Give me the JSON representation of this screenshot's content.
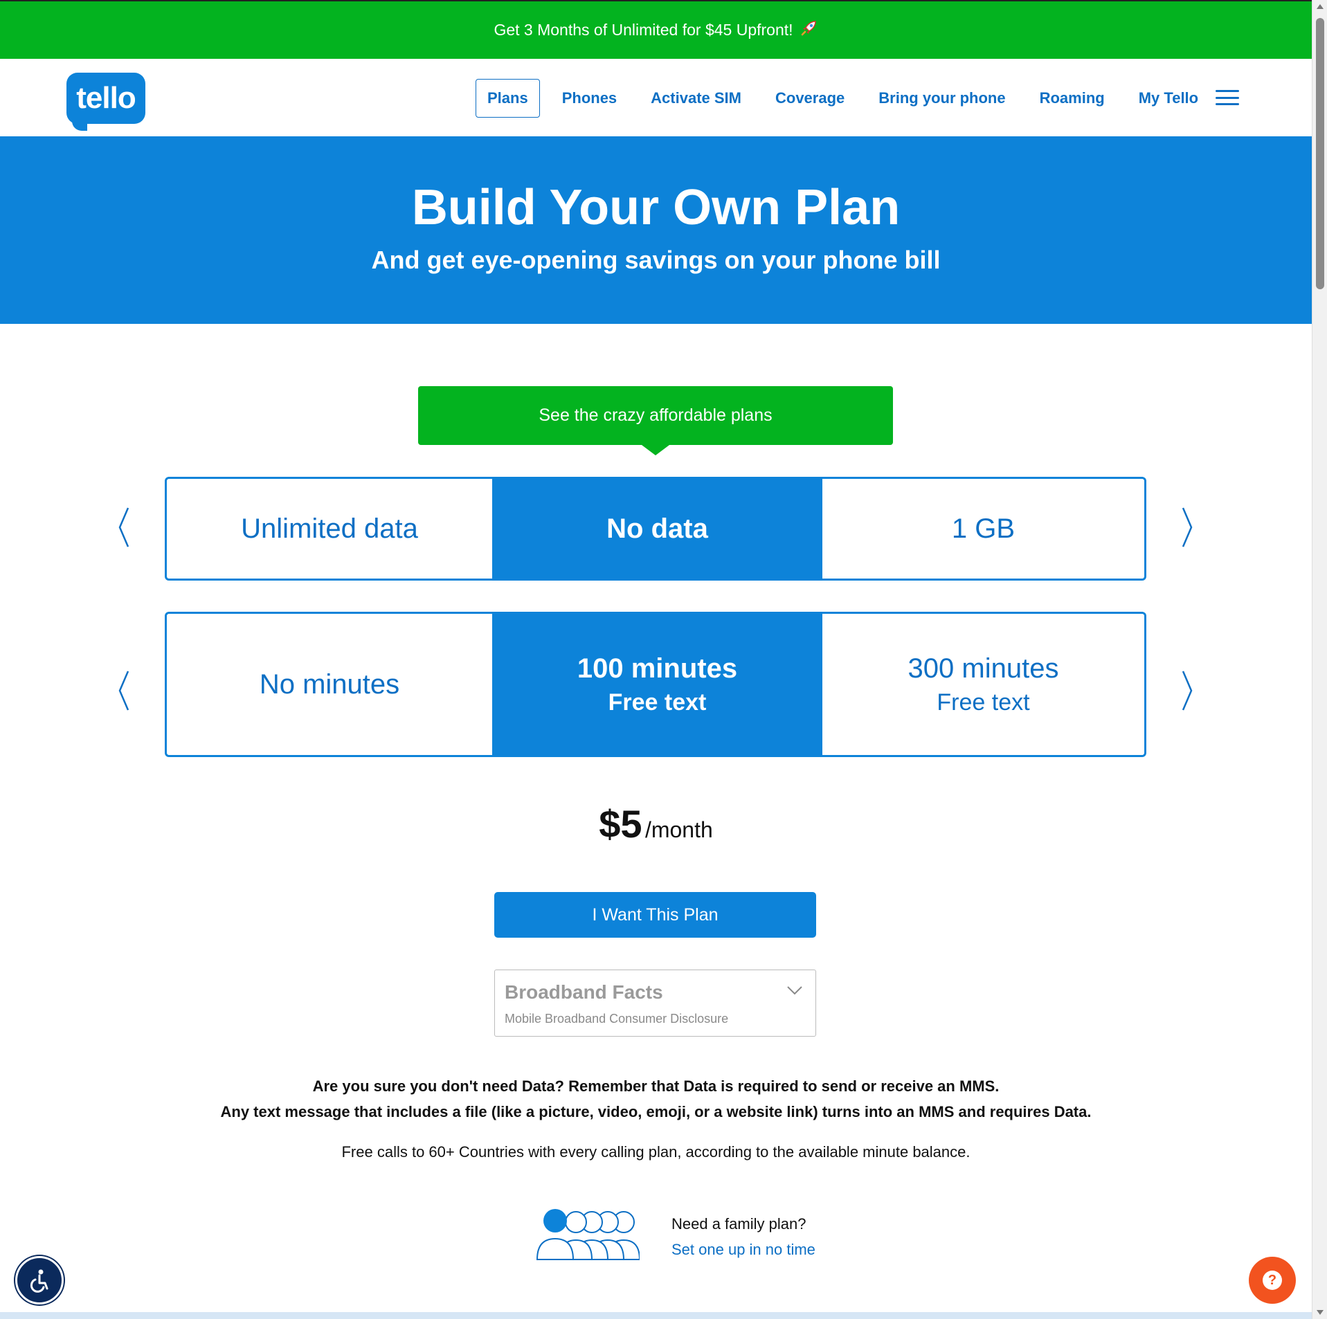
{
  "promo": {
    "text": "Get 3 Months of Unlimited for $45 Upfront!",
    "icon": "rocket-icon",
    "bg_color": "#03b31f"
  },
  "header": {
    "logo_text": "tello",
    "nav": [
      {
        "label": "Plans",
        "active": true
      },
      {
        "label": "Phones"
      },
      {
        "label": "Activate SIM"
      },
      {
        "label": "Coverage"
      },
      {
        "label": "Bring your phone"
      },
      {
        "label": "Roaming"
      },
      {
        "label": "My Tello"
      }
    ],
    "menu_icon": "hamburger-menu-icon"
  },
  "hero": {
    "title": "Build Your Own Plan",
    "subtitle": "And get eye-opening savings on your phone bill",
    "bg_color": "#0d83d9"
  },
  "cta": {
    "label": "See the crazy affordable plans"
  },
  "data_options": {
    "items": [
      "Unlimited data",
      "No data",
      "1 GB"
    ],
    "selected": "No data"
  },
  "minutes_options": {
    "items": [
      {
        "line1": "No minutes",
        "line2": ""
      },
      {
        "line1": "100 minutes",
        "line2": "Free text"
      },
      {
        "line1": "300 minutes",
        "line2": "Free text"
      }
    ],
    "selected": "100 minutes"
  },
  "price": {
    "amount": "$5",
    "period": "/month"
  },
  "plan_button": {
    "label": "I Want This Plan"
  },
  "broadband": {
    "title": "Broadband Facts",
    "subtitle": "Mobile Broadband Consumer Disclosure"
  },
  "warning": {
    "line1": "Are you sure you don't need Data? Remember that Data is required to send or receive an MMS.",
    "line2": "Any text message that includes a file (like a picture, video, emoji, or a website link) turns into an MMS and requires Data."
  },
  "free_calls": "Free calls to 60+ Countries with every calling plan, according to the available minute balance.",
  "family": {
    "question": "Need a family plan?",
    "link": "Set one up in no time"
  },
  "widgets": {
    "accessibility_icon": "accessibility-icon",
    "help_icon": "help-chat-icon",
    "help_glyph": "?"
  },
  "accent_color": "#0d83d9",
  "link_color": "#0d6fc4"
}
